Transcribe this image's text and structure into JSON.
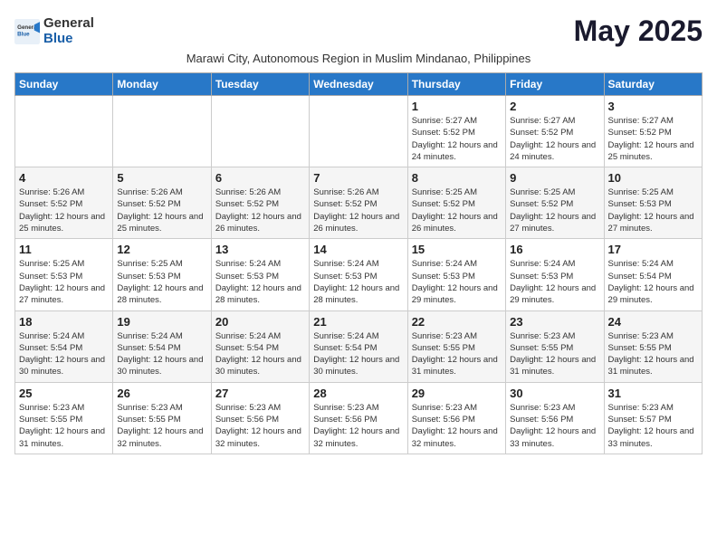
{
  "header": {
    "logo_general": "General",
    "logo_blue": "Blue",
    "month_title": "May 2025",
    "subtitle": "Marawi City, Autonomous Region in Muslim Mindanao, Philippines"
  },
  "days_of_week": [
    "Sunday",
    "Monday",
    "Tuesday",
    "Wednesday",
    "Thursday",
    "Friday",
    "Saturday"
  ],
  "weeks": [
    [
      {
        "day": "",
        "info": ""
      },
      {
        "day": "",
        "info": ""
      },
      {
        "day": "",
        "info": ""
      },
      {
        "day": "",
        "info": ""
      },
      {
        "day": "1",
        "info": "Sunrise: 5:27 AM\nSunset: 5:52 PM\nDaylight: 12 hours and 24 minutes."
      },
      {
        "day": "2",
        "info": "Sunrise: 5:27 AM\nSunset: 5:52 PM\nDaylight: 12 hours and 24 minutes."
      },
      {
        "day": "3",
        "info": "Sunrise: 5:27 AM\nSunset: 5:52 PM\nDaylight: 12 hours and 25 minutes."
      }
    ],
    [
      {
        "day": "4",
        "info": "Sunrise: 5:26 AM\nSunset: 5:52 PM\nDaylight: 12 hours and 25 minutes."
      },
      {
        "day": "5",
        "info": "Sunrise: 5:26 AM\nSunset: 5:52 PM\nDaylight: 12 hours and 25 minutes."
      },
      {
        "day": "6",
        "info": "Sunrise: 5:26 AM\nSunset: 5:52 PM\nDaylight: 12 hours and 26 minutes."
      },
      {
        "day": "7",
        "info": "Sunrise: 5:26 AM\nSunset: 5:52 PM\nDaylight: 12 hours and 26 minutes."
      },
      {
        "day": "8",
        "info": "Sunrise: 5:25 AM\nSunset: 5:52 PM\nDaylight: 12 hours and 26 minutes."
      },
      {
        "day": "9",
        "info": "Sunrise: 5:25 AM\nSunset: 5:52 PM\nDaylight: 12 hours and 27 minutes."
      },
      {
        "day": "10",
        "info": "Sunrise: 5:25 AM\nSunset: 5:53 PM\nDaylight: 12 hours and 27 minutes."
      }
    ],
    [
      {
        "day": "11",
        "info": "Sunrise: 5:25 AM\nSunset: 5:53 PM\nDaylight: 12 hours and 27 minutes."
      },
      {
        "day": "12",
        "info": "Sunrise: 5:25 AM\nSunset: 5:53 PM\nDaylight: 12 hours and 28 minutes."
      },
      {
        "day": "13",
        "info": "Sunrise: 5:24 AM\nSunset: 5:53 PM\nDaylight: 12 hours and 28 minutes."
      },
      {
        "day": "14",
        "info": "Sunrise: 5:24 AM\nSunset: 5:53 PM\nDaylight: 12 hours and 28 minutes."
      },
      {
        "day": "15",
        "info": "Sunrise: 5:24 AM\nSunset: 5:53 PM\nDaylight: 12 hours and 29 minutes."
      },
      {
        "day": "16",
        "info": "Sunrise: 5:24 AM\nSunset: 5:53 PM\nDaylight: 12 hours and 29 minutes."
      },
      {
        "day": "17",
        "info": "Sunrise: 5:24 AM\nSunset: 5:54 PM\nDaylight: 12 hours and 29 minutes."
      }
    ],
    [
      {
        "day": "18",
        "info": "Sunrise: 5:24 AM\nSunset: 5:54 PM\nDaylight: 12 hours and 30 minutes."
      },
      {
        "day": "19",
        "info": "Sunrise: 5:24 AM\nSunset: 5:54 PM\nDaylight: 12 hours and 30 minutes."
      },
      {
        "day": "20",
        "info": "Sunrise: 5:24 AM\nSunset: 5:54 PM\nDaylight: 12 hours and 30 minutes."
      },
      {
        "day": "21",
        "info": "Sunrise: 5:24 AM\nSunset: 5:54 PM\nDaylight: 12 hours and 30 minutes."
      },
      {
        "day": "22",
        "info": "Sunrise: 5:23 AM\nSunset: 5:55 PM\nDaylight: 12 hours and 31 minutes."
      },
      {
        "day": "23",
        "info": "Sunrise: 5:23 AM\nSunset: 5:55 PM\nDaylight: 12 hours and 31 minutes."
      },
      {
        "day": "24",
        "info": "Sunrise: 5:23 AM\nSunset: 5:55 PM\nDaylight: 12 hours and 31 minutes."
      }
    ],
    [
      {
        "day": "25",
        "info": "Sunrise: 5:23 AM\nSunset: 5:55 PM\nDaylight: 12 hours and 31 minutes."
      },
      {
        "day": "26",
        "info": "Sunrise: 5:23 AM\nSunset: 5:55 PM\nDaylight: 12 hours and 32 minutes."
      },
      {
        "day": "27",
        "info": "Sunrise: 5:23 AM\nSunset: 5:56 PM\nDaylight: 12 hours and 32 minutes."
      },
      {
        "day": "28",
        "info": "Sunrise: 5:23 AM\nSunset: 5:56 PM\nDaylight: 12 hours and 32 minutes."
      },
      {
        "day": "29",
        "info": "Sunrise: 5:23 AM\nSunset: 5:56 PM\nDaylight: 12 hours and 32 minutes."
      },
      {
        "day": "30",
        "info": "Sunrise: 5:23 AM\nSunset: 5:56 PM\nDaylight: 12 hours and 33 minutes."
      },
      {
        "day": "31",
        "info": "Sunrise: 5:23 AM\nSunset: 5:57 PM\nDaylight: 12 hours and 33 minutes."
      }
    ]
  ]
}
